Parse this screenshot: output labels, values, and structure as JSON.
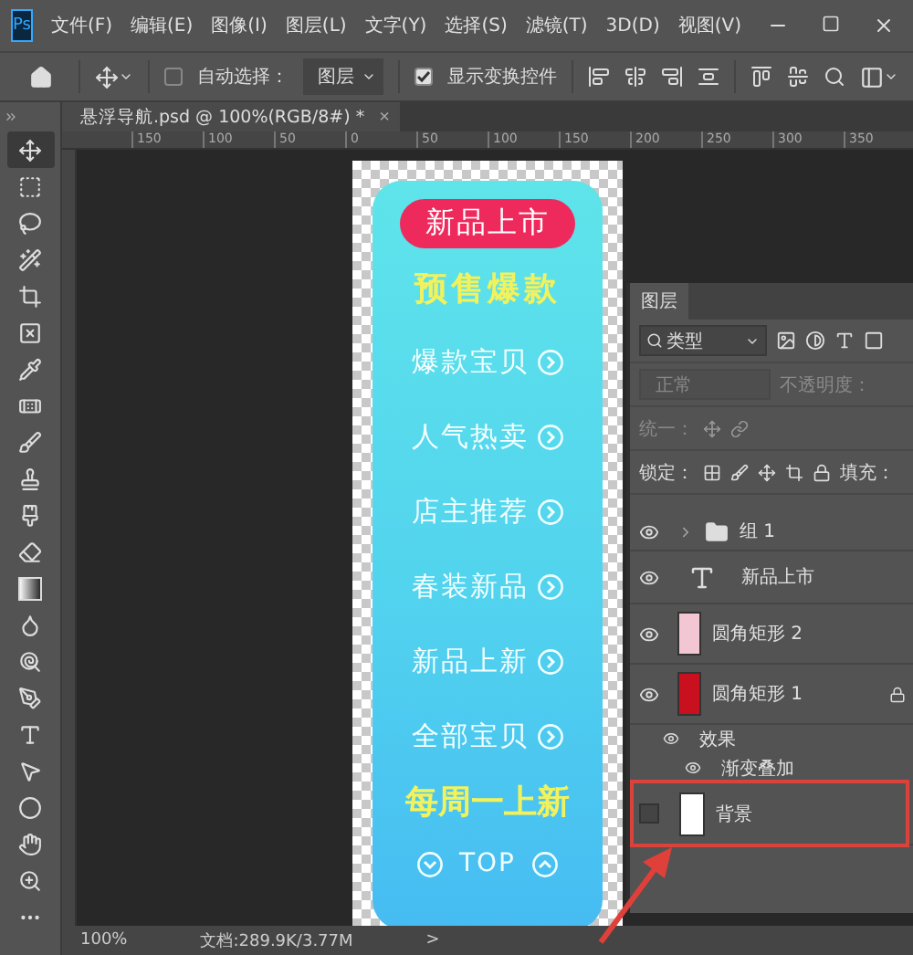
{
  "app_logo": "Ps",
  "menu": [
    "文件(F)",
    "编辑(E)",
    "图像(I)",
    "图层(L)",
    "文字(Y)",
    "选择(S)",
    "滤镜(T)",
    "3D(D)",
    "视图(V)"
  ],
  "options_bar": {
    "auto_select": {
      "label": "自动选择：",
      "checked": false
    },
    "target": "图层",
    "show_transform": {
      "label": "显示变换控件",
      "checked": true
    }
  },
  "tools": [
    {
      "selected": true
    },
    {
      "selected": false
    },
    {
      "selected": false
    },
    {
      "selected": false
    },
    {
      "selected": false
    },
    {
      "selected": false
    },
    {
      "selected": false
    },
    {
      "selected": false
    },
    {
      "selected": false
    },
    {
      "selected": false
    },
    {
      "selected": false
    },
    {
      "selected": false
    },
    {
      "selected": false
    },
    {
      "selected": false
    },
    {
      "selected": false
    },
    {
      "selected": false
    },
    {
      "selected": false
    },
    {
      "selected": false
    },
    {
      "selected": false
    },
    {
      "selected": false
    },
    {
      "selected": false
    },
    {
      "selected": false
    }
  ],
  "document_tab": {
    "title": "悬浮导航.psd @ 100%(RGB/8#) *",
    "close": "×"
  },
  "ruler": [
    "150",
    "100",
    "50",
    "0",
    "50",
    "100",
    "150",
    "200",
    "250",
    "300",
    "350"
  ],
  "nav_card": {
    "badge": "新品上市",
    "heading": "预售爆款",
    "links": [
      "爆款宝贝",
      "人气热卖",
      "店主推荐",
      "春装新品",
      "新品上新",
      "全部宝贝"
    ],
    "footer": "每周一上新",
    "top": "TOP"
  },
  "layers_panel": {
    "title": "图层",
    "filter": "类型",
    "blend_mode": "正常",
    "opacity_label": "不透明度：",
    "unify_label": "统一：",
    "lock_label": "锁定：",
    "fill_label": "填充：",
    "layers": [
      {
        "kind": "group",
        "name": "组 1",
        "visible": true,
        "locked": false,
        "expanded": false
      },
      {
        "kind": "text",
        "name": "新品上市",
        "visible": true,
        "locked": false
      },
      {
        "kind": "shape",
        "name": "圆角矩形 2",
        "visible": true,
        "locked": false,
        "color": "#f2c6d2"
      },
      {
        "kind": "shape",
        "name": "圆角矩形 1",
        "visible": true,
        "locked": true,
        "color": "#c8101e",
        "children": [
          {
            "kind": "effects",
            "name": "效果",
            "visible": true,
            "children": [
              {
                "kind": "effect",
                "name": "渐变叠加",
                "visible": true
              }
            ]
          }
        ]
      },
      {
        "kind": "background",
        "name": "背景",
        "visible": false,
        "locked": false,
        "highlighted": true
      }
    ]
  },
  "status_bar": {
    "zoom": "100%",
    "doc_info": "文档:289.9K/3.77M",
    "arrow": ">"
  }
}
